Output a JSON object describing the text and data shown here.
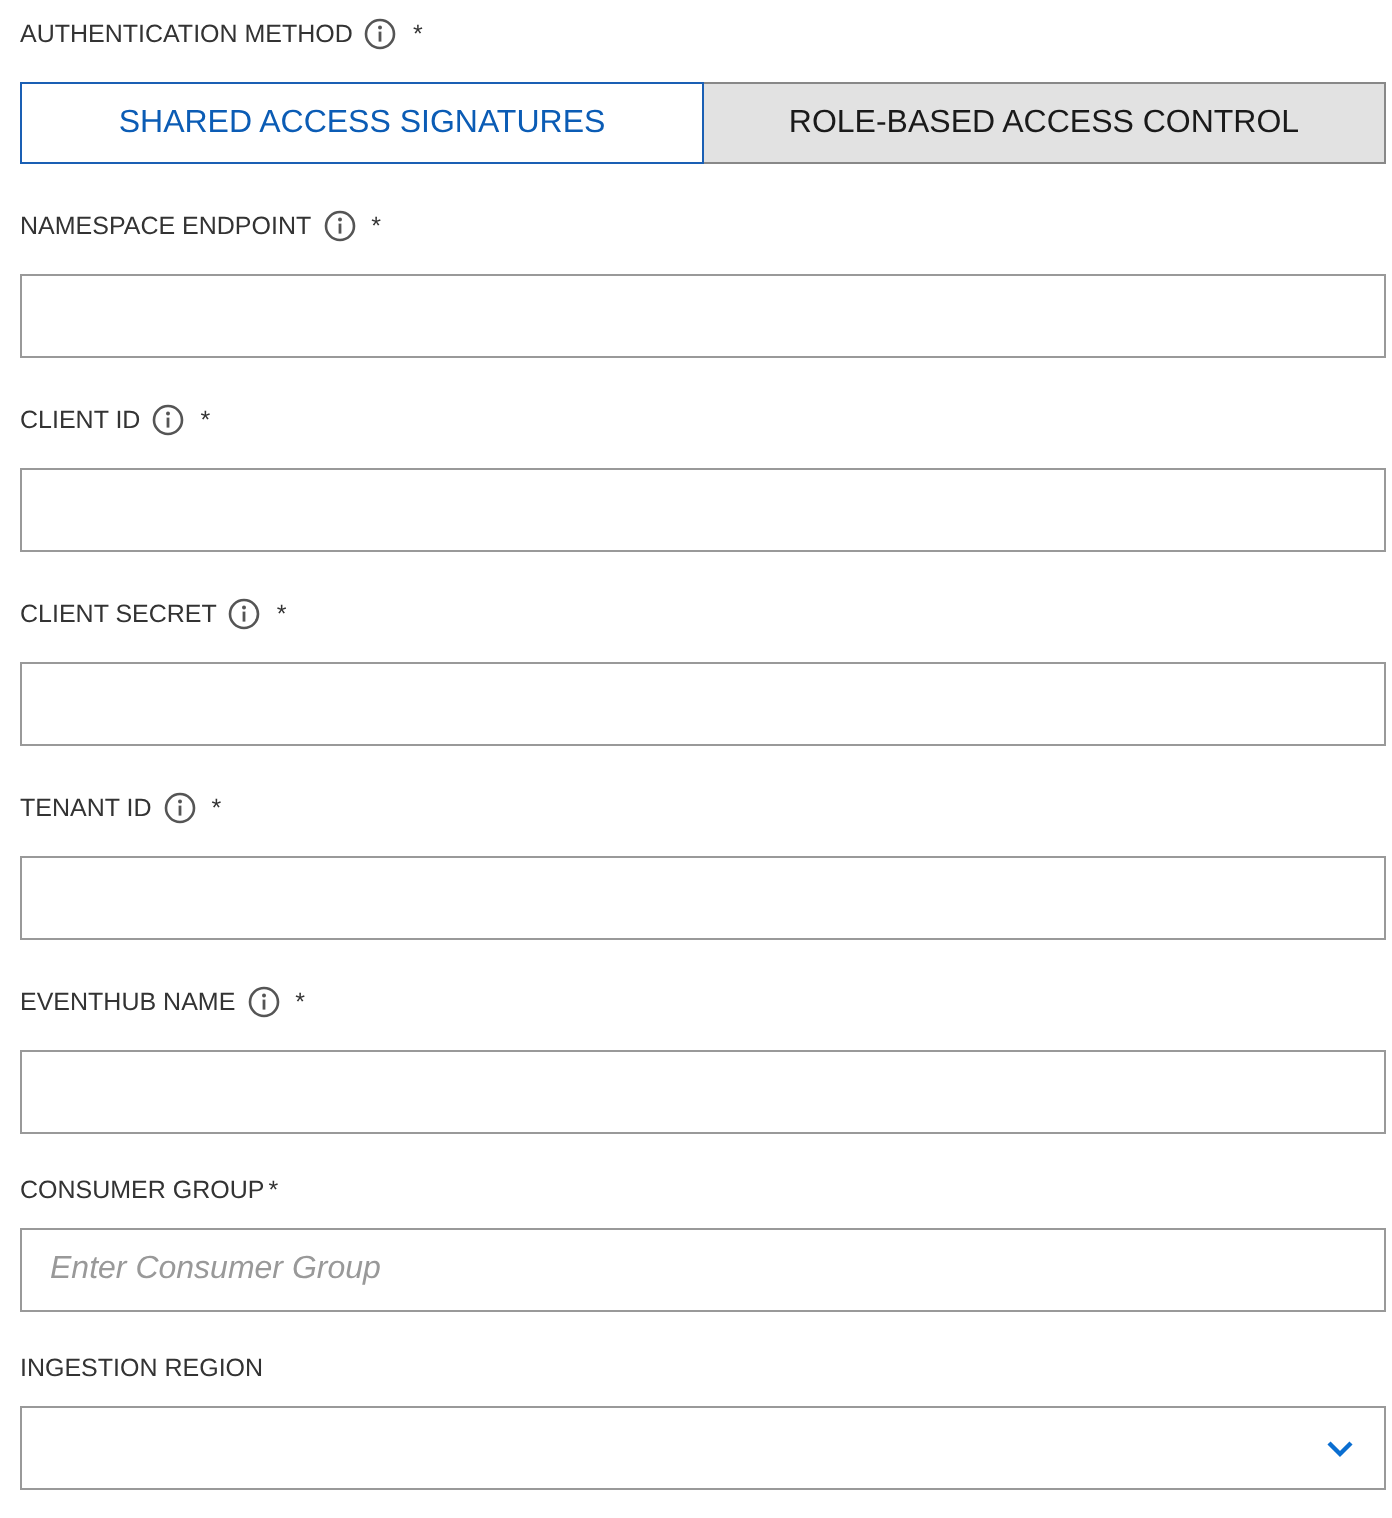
{
  "auth": {
    "label": "AUTHENTICATION METHOD",
    "info": true,
    "required_mark": "*",
    "tabs": [
      {
        "label": "SHARED ACCESS SIGNATURES",
        "selected": true
      },
      {
        "label": "ROLE-BASED ACCESS CONTROL",
        "selected": false
      }
    ]
  },
  "fields": [
    {
      "kind": "text",
      "label": "NAMESPACE ENDPOINT",
      "info": true,
      "required_mark": "*"
    },
    {
      "kind": "text",
      "label": "CLIENT ID",
      "info": true,
      "required_mark": "*"
    },
    {
      "kind": "text",
      "label": "CLIENT SECRET",
      "info": true,
      "required_mark": "*"
    },
    {
      "kind": "text",
      "label": "TENANT ID",
      "info": true,
      "required_mark": "*"
    },
    {
      "kind": "text",
      "label": "EVENTHUB NAME",
      "info": true,
      "required_mark": "*"
    },
    {
      "kind": "text",
      "label": "CONSUMER GROUP",
      "info": false,
      "required_mark": "*",
      "placeholder": "Enter Consumer Group"
    },
    {
      "kind": "select",
      "label": "INGESTION REGION",
      "info": false
    }
  ]
}
